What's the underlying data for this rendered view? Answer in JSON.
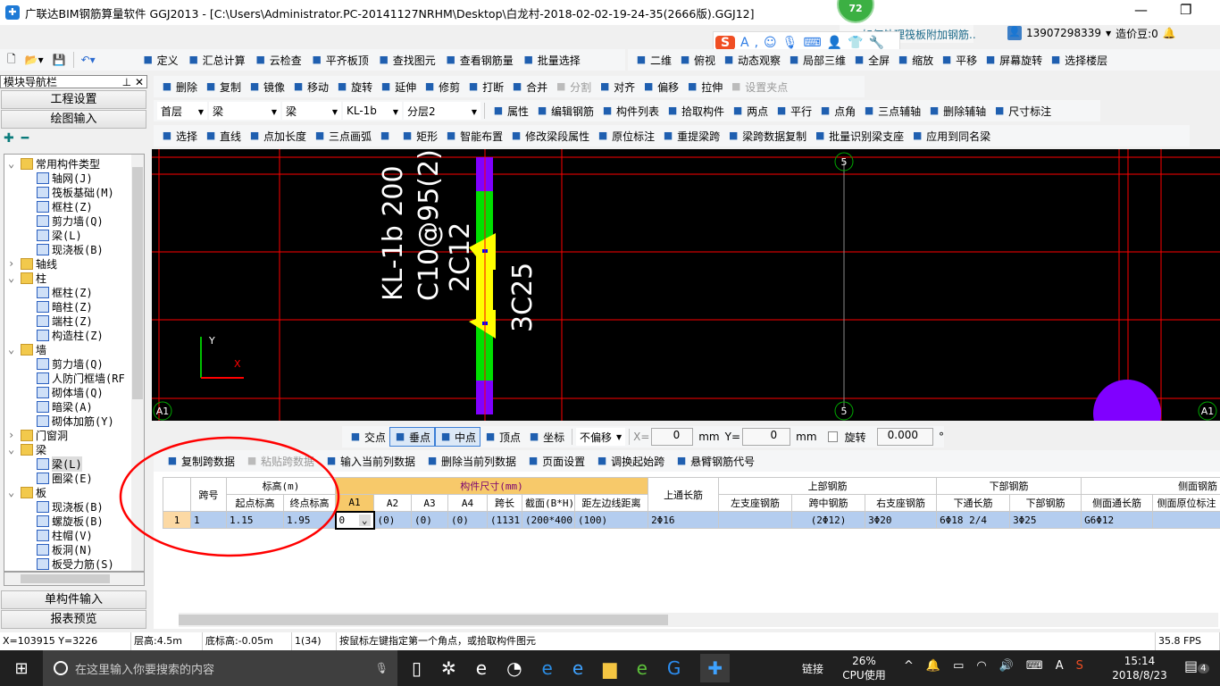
{
  "title": "广联达BIM钢筋算量软件 GGJ2013 - [C:\\Users\\Administrator.PC-20141127NRHM\\Desktop\\白龙村-2018-02-02-19-24-35(2666版).GGJ12]",
  "badge": "72",
  "notice": "如何处理筏板附加钢筋..",
  "user": {
    "phone": "13907298339",
    "beans": "造价豆:0"
  },
  "toolbar1": [
    "定义",
    "汇总计算",
    "云检查",
    "平齐板顶",
    "查找图元",
    "查看钢筋量",
    "批量选择"
  ],
  "toolbar1b": [
    "二维",
    "俯视",
    "动态观察",
    "局部三维",
    "全屏",
    "缩放",
    "平移",
    "屏幕旋转",
    "选择楼层"
  ],
  "toolbar2": [
    {
      "l": "删除"
    },
    {
      "l": "复制"
    },
    {
      "l": "镜像"
    },
    {
      "l": "移动"
    },
    {
      "l": "旋转"
    },
    {
      "l": "延伸"
    },
    {
      "l": "修剪"
    },
    {
      "l": "打断"
    },
    {
      "l": "合并"
    },
    {
      "l": "分割",
      "dis": true
    },
    {
      "l": "对齐"
    },
    {
      "l": "偏移"
    },
    {
      "l": "拉伸"
    },
    {
      "l": "设置夹点",
      "dis": true
    }
  ],
  "selectors": [
    "首层",
    "梁",
    "梁",
    "KL-1b",
    "分层2"
  ],
  "toolbar3": [
    "属性",
    "编辑钢筋",
    "构件列表",
    "拾取构件",
    "两点",
    "平行",
    "点角",
    "三点辅轴",
    "删除辅轴",
    "尺寸标注"
  ],
  "toolbar4": [
    "选择",
    "直线",
    "点加长度",
    "三点画弧",
    "",
    "矩形",
    "智能布置",
    "修改梁段属性",
    "原位标注",
    "重提梁跨",
    "梁跨数据复制",
    "批量识别梁支座",
    "应用到同名梁"
  ],
  "nav": {
    "title": "模块导航栏",
    "settings": "工程设置",
    "draw": "绘图输入",
    "single": "单构件输入",
    "report": "报表预览"
  },
  "tree": [
    {
      "l": "常用构件类型",
      "lv": 0,
      "f": "open"
    },
    {
      "l": "轴网(J)",
      "lv": 1
    },
    {
      "l": "筏板基础(M)",
      "lv": 1
    },
    {
      "l": "框柱(Z)",
      "lv": 1
    },
    {
      "l": "剪力墙(Q)",
      "lv": 1
    },
    {
      "l": "梁(L)",
      "lv": 1
    },
    {
      "l": "现浇板(B)",
      "lv": 1
    },
    {
      "l": "轴线",
      "lv": 0,
      "f": "closed"
    },
    {
      "l": "柱",
      "lv": 0,
      "f": "open"
    },
    {
      "l": "框柱(Z)",
      "lv": 1
    },
    {
      "l": "暗柱(Z)",
      "lv": 1
    },
    {
      "l": "端柱(Z)",
      "lv": 1
    },
    {
      "l": "构造柱(Z)",
      "lv": 1
    },
    {
      "l": "墙",
      "lv": 0,
      "f": "open"
    },
    {
      "l": "剪力墙(Q)",
      "lv": 1
    },
    {
      "l": "人防门框墙(RF",
      "lv": 1
    },
    {
      "l": "砌体墙(Q)",
      "lv": 1
    },
    {
      "l": "暗梁(A)",
      "lv": 1
    },
    {
      "l": "砌体加筋(Y)",
      "lv": 1
    },
    {
      "l": "门窗洞",
      "lv": 0,
      "f": "closed"
    },
    {
      "l": "梁",
      "lv": 0,
      "f": "open"
    },
    {
      "l": "梁(L)",
      "lv": 1,
      "sel": true
    },
    {
      "l": "圈梁(E)",
      "lv": 1
    },
    {
      "l": "板",
      "lv": 0,
      "f": "open"
    },
    {
      "l": "现浇板(B)",
      "lv": 1
    },
    {
      "l": "螺旋板(B)",
      "lv": 1
    },
    {
      "l": "柱帽(V)",
      "lv": 1
    },
    {
      "l": "板洞(N)",
      "lv": 1
    },
    {
      "l": "板受力筋(S)",
      "lv": 1
    }
  ],
  "canvas": {
    "axis_labels": [
      "A1",
      "5",
      "5",
      "A1"
    ],
    "beam_text": [
      "KL-1b 200",
      "C10@95(2)",
      "2C12",
      "3C25"
    ],
    "ucs": {
      "x": "X",
      "y": "Y"
    }
  },
  "snap": {
    "items": [
      "交点",
      "垂点",
      "中点",
      "顶点",
      "坐标"
    ],
    "offset": "不偏移",
    "x_label": "X=",
    "x": "0",
    "y_label": "Y=",
    "y": "0",
    "unit": "mm",
    "rotate": "旋转",
    "angle": "0.000",
    "deg": "°"
  },
  "table_toolbar": [
    {
      "l": "复制跨数据"
    },
    {
      "l": "粘贴跨数据",
      "dis": true
    },
    {
      "l": "输入当前列数据"
    },
    {
      "l": "删除当前列数据"
    },
    {
      "l": "页面设置"
    },
    {
      "l": "调换起始跨"
    },
    {
      "l": "悬臂钢筋代号"
    }
  ],
  "table": {
    "groups": {
      "span": "跨号",
      "elev": "标高(m)",
      "size": "构件尺寸(mm)",
      "top_through": "上通长筋",
      "top": "上部钢筋",
      "bottom": "下部钢筋",
      "side": "侧面钢筋"
    },
    "cols": [
      "起点标高",
      "终点标高",
      "A1",
      "A2",
      "A3",
      "A4",
      "跨长",
      "截面(B*H)",
      "距左边线距离",
      "左支座钢筋",
      "跨中钢筋",
      "右支座钢筋",
      "下通长筋",
      "下部钢筋",
      "侧面通长筋",
      "侧面原位标注"
    ],
    "row": {
      "idx": "1",
      "span": "1",
      "start": "1.15",
      "end": "1.95",
      "a1": "0",
      "a2": "(0)",
      "a3": "(0)",
      "a4": "(0)",
      "len": "(1131)",
      "sec": "(200*400)",
      "dist": "(100)",
      "top_through": "2Φ16",
      "left": "",
      "mid": "(2Φ12)",
      "right": "3Φ20",
      "bot_through": "6Φ18 2/4",
      "bot": "3Φ25",
      "side_through": "G6Φ12",
      "side_in": ""
    }
  },
  "status": {
    "coord": "X=103915 Y=3226",
    "floor_h": "层高:4.5m",
    "base": "底标高:-0.05m",
    "count": "1(34)",
    "hint": "按鼠标左键指定第一个角点，或拾取构件图元",
    "fps": "35.8 FPS"
  },
  "taskbar": {
    "search": "在这里输入你要搜索的内容",
    "link": "链接",
    "cpu": "26%",
    "cpu_label": "CPU使用",
    "time": "15:14",
    "date": "2018/8/23",
    "notif": "4"
  },
  "colors": {
    "canvas": "#000000",
    "grid": "#ff0000",
    "beam_green": "#00e000",
    "beam_purple": "#8000ff",
    "support": "#ffff00",
    "annotation": "#ff0000",
    "row_sel": "#b4cdef",
    "header_orange": "#f7c96a"
  }
}
